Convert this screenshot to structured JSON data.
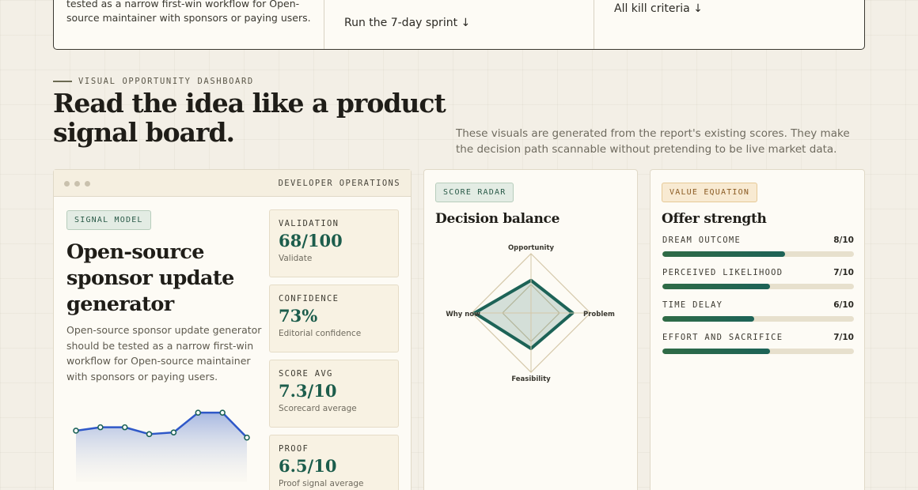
{
  "top_strip": {
    "col1_text": "tested as a narrow first-win workflow for Open-source maintainer with sponsors or paying users.",
    "col2_link": "Run the 7-day sprint ↓",
    "col3_link": "All kill criteria ↓"
  },
  "section": {
    "eyebrow": "VISUAL OPPORTUNITY DASHBOARD",
    "headline": "Read the idea like a product signal board.",
    "intro": "These visuals are generated from the report's existing scores. They make the decision path scannable without pretending to be live market data."
  },
  "main_card": {
    "bar_title": "DEVELOPER OPERATIONS",
    "pill": "SIGNAL MODEL",
    "title": "Open-source sponsor update generator",
    "description": "Open-source sponsor update generator should be tested as a narrow first-win workflow for Open-source maintainer with sponsors or paying users.",
    "sparkline": [
      6.2,
      6.6,
      6.6,
      5.8,
      6.0,
      8.3,
      8.3,
      5.4
    ],
    "metrics": [
      {
        "label": "VALIDATION",
        "value": "68/100",
        "sub": "Validate"
      },
      {
        "label": "CONFIDENCE",
        "value": "73%",
        "sub": "Editorial confidence"
      },
      {
        "label": "SCORE AVG",
        "value": "7.3/10",
        "sub": "Scorecard average"
      },
      {
        "label": "PROOF",
        "value": "6.5/10",
        "sub": "Proof signal average"
      }
    ]
  },
  "radar_card": {
    "pill": "SCORE RADAR",
    "title": "Decision balance",
    "axes": [
      {
        "label": "Opportunity",
        "value": 0.55
      },
      {
        "label": "Problem",
        "value": 0.7
      },
      {
        "label": "Feasibility",
        "value": 0.6
      },
      {
        "label": "Why now",
        "value": 0.95
      }
    ]
  },
  "offer_card": {
    "pill": "VALUE EQUATION",
    "title": "Offer strength",
    "bars": [
      {
        "label": "DREAM OUTCOME",
        "score": "8/10",
        "value": 8
      },
      {
        "label": "PERCEIVED LIKELIHOOD",
        "score": "7/10",
        "value": 7
      },
      {
        "label": "TIME DELAY",
        "score": "6/10",
        "value": 6
      },
      {
        "label": "EFFORT AND SACRIFICE",
        "score": "7/10",
        "value": 7
      }
    ]
  },
  "colors": {
    "accent": "#1c5d4c",
    "spark_line": "#2f58c8",
    "radar_stroke": "#1d6357",
    "paper": "#fdfbf5"
  }
}
